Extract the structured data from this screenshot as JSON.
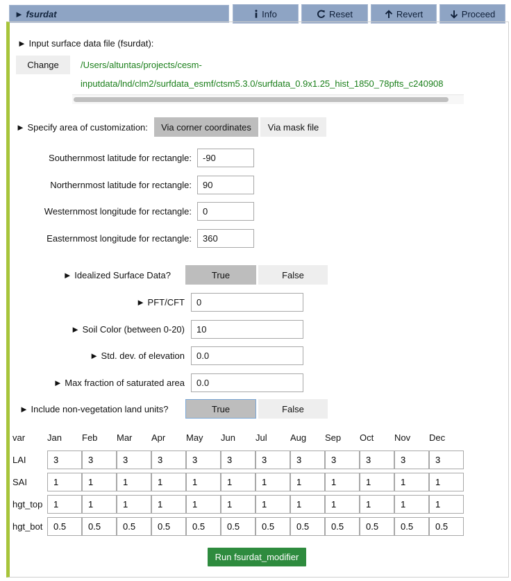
{
  "header": {
    "title": "► fsurdat",
    "info": "Info",
    "reset": "Reset",
    "revert": "Revert",
    "proceed": "Proceed"
  },
  "input_file": {
    "label": "► Input surface data file (fsurdat):",
    "change": "Change",
    "path_line1": "/Users/altuntas/projects/cesm-",
    "path_line2": "inputdata/lnd/clm2/surfdata_esmf/ctsm5.3.0/surfdata_0.9x1.25_hist_1850_78pfts_c240908"
  },
  "area": {
    "label": "► Specify area of customization:",
    "opt_corner": "Via corner coordinates",
    "opt_mask": "Via mask file",
    "selected": "Via corner coordinates"
  },
  "rect": {
    "south_label": "Southernmost latitude for rectangle:",
    "south": "-90",
    "north_label": "Northernmost latitude for rectangle:",
    "north": "90",
    "west_label": "Westernmost longitude for rectangle:",
    "west": "0",
    "east_label": "Easternmost longitude for rectangle:",
    "east": "360"
  },
  "idealized": {
    "label": "► Idealized Surface Data?",
    "true": "True",
    "false": "False",
    "selected": "True",
    "pft_label": "► PFT/CFT",
    "pft": "0",
    "soil_label": "► Soil Color (between 0-20)",
    "soil": "10",
    "std_label": "► Std. dev. of elevation",
    "std": "0.0",
    "maxfrac_label": "► Max fraction of saturated area",
    "maxfrac": "0.0"
  },
  "nonveg": {
    "label": "► Include non-vegetation land units?",
    "true": "True",
    "false": "False",
    "selected": "True"
  },
  "table": {
    "var_header": "var",
    "months": [
      "Jan",
      "Feb",
      "Mar",
      "Apr",
      "May",
      "Jun",
      "Jul",
      "Aug",
      "Sep",
      "Oct",
      "Nov",
      "Dec"
    ],
    "rows": [
      {
        "name": "LAI",
        "values": [
          "3",
          "3",
          "3",
          "3",
          "3",
          "3",
          "3",
          "3",
          "3",
          "3",
          "3",
          "3"
        ]
      },
      {
        "name": "SAI",
        "values": [
          "1",
          "1",
          "1",
          "1",
          "1",
          "1",
          "1",
          "1",
          "1",
          "1",
          "1",
          "1"
        ]
      },
      {
        "name": "hgt_top",
        "values": [
          "1",
          "1",
          "1",
          "1",
          "1",
          "1",
          "1",
          "1",
          "1",
          "1",
          "1",
          "1"
        ]
      },
      {
        "name": "hgt_bot",
        "values": [
          "0.5",
          "0.5",
          "0.5",
          "0.5",
          "0.5",
          "0.5",
          "0.5",
          "0.5",
          "0.5",
          "0.5",
          "0.5",
          "0.5"
        ]
      }
    ]
  },
  "run_label": "Run fsurdat_modifier"
}
